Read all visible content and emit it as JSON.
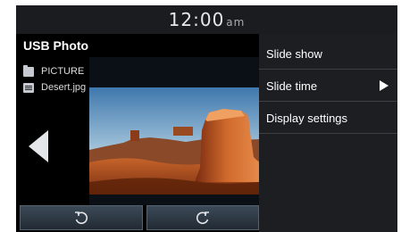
{
  "status": {
    "time": "12:00",
    "ampm": "am"
  },
  "header": {
    "title": "USB Photo"
  },
  "files": [
    {
      "name": "PICTURE",
      "icon": "folder-icon"
    },
    {
      "name": "Desert.jpg",
      "icon": "image-file-icon"
    }
  ],
  "controls": [
    {
      "name": "rotate-left-button",
      "icon": "rotate-counterclockwise-icon"
    },
    {
      "name": "rotate-right-button",
      "icon": "rotate-clockwise-icon"
    }
  ],
  "menu": {
    "items": [
      {
        "label": "Slide show"
      },
      {
        "label": "Slide time",
        "has_submenu": true
      },
      {
        "label": "Display settings"
      }
    ]
  },
  "colors": {
    "menu_bg": "#1c1e22",
    "status_bg": "#1a1c20",
    "control_bg": "#2f3a45"
  }
}
